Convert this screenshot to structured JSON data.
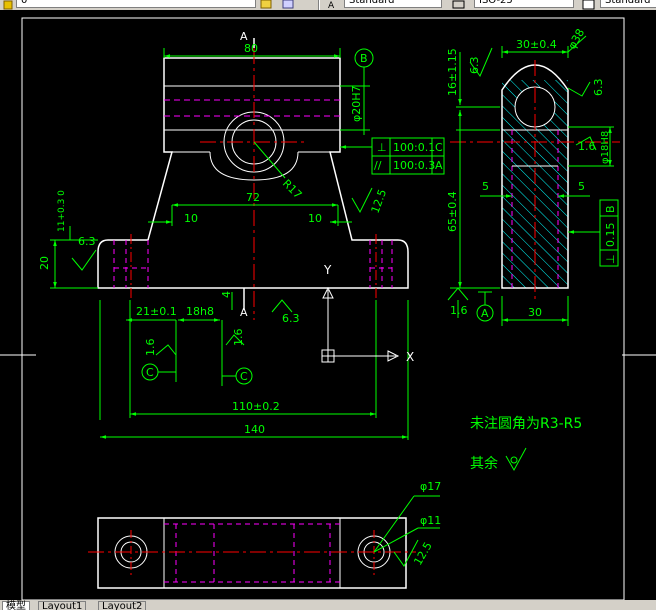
{
  "toolbar": {
    "layer_value": "0",
    "text_style": "Standard",
    "dim_style": "ISO-25",
    "table_style": "Standard"
  },
  "drawing": {
    "front_view": {
      "dim_top_width": "80",
      "section_marker_top": "A",
      "section_marker_bottom": "A",
      "dim_hole_fit": "φ20H7",
      "radius_label": "R17",
      "datum_b_symbol": "B",
      "tolerance_frame_1": {
        "symbol": "⊥",
        "value": "100:0.1",
        "datum": "C"
      },
      "tolerance_frame_2": {
        "symbol": "//",
        "value": "100:0.3",
        "datum": "A"
      },
      "dim_72": "72",
      "dim_10_left": "10",
      "dim_10_right": "10",
      "roughness_right": "12.5",
      "dim_11_tol": "11+0.3 0",
      "roughness_left": "6.3",
      "dim_20": "20",
      "dim_4": "4",
      "roughness_bottom": "6.3",
      "dim_21": "21±0.1",
      "dim_18h8": "18h8",
      "roughness_16a": "1.6",
      "roughness_16b": "1.6",
      "datum_c_left": "C",
      "datum_c_right": "C",
      "dim_110": "110±0.2",
      "dim_140": "140"
    },
    "ucs": {
      "x_label": "X",
      "y_label": "Y"
    },
    "side_view": {
      "dim_30_tol": "30±0.4",
      "dim_phi38": "φ38",
      "dim_16_tol": "16±1.15",
      "roughness_top": "6.3",
      "roughness_right_top": "6.3",
      "dim_hole_18h8": "φ18H8",
      "roughness_16_right": "1.6",
      "dim_5_left": "5",
      "dim_5_right": "5",
      "dim_65_tol": "65±0.4",
      "tolerance_frame_3": {
        "symbol": "⊥",
        "value": "0.15",
        "datum": "B"
      },
      "roughness_bottom": "1.6",
      "datum_a_symbol": "A",
      "dim_30_bottom": "30"
    },
    "notes": {
      "fillet_note": "未注圆角为R3-R5",
      "remaining_note": "其余"
    },
    "top_view": {
      "dim_phi17": "φ17",
      "dim_phi11": "φ11",
      "roughness": "12.5"
    }
  },
  "layout_tabs": [
    {
      "label": "模型",
      "active": true
    },
    {
      "label": "Layout1",
      "active": false
    },
    {
      "label": "Layout2",
      "active": false
    }
  ],
  "colors": {
    "background": "#000000",
    "geometry": "#ffffff",
    "dimensions": "#00ff00",
    "centerlines": "#ff0000",
    "hidden_lines": "#ff00ff",
    "hatch": "#00ffff"
  }
}
